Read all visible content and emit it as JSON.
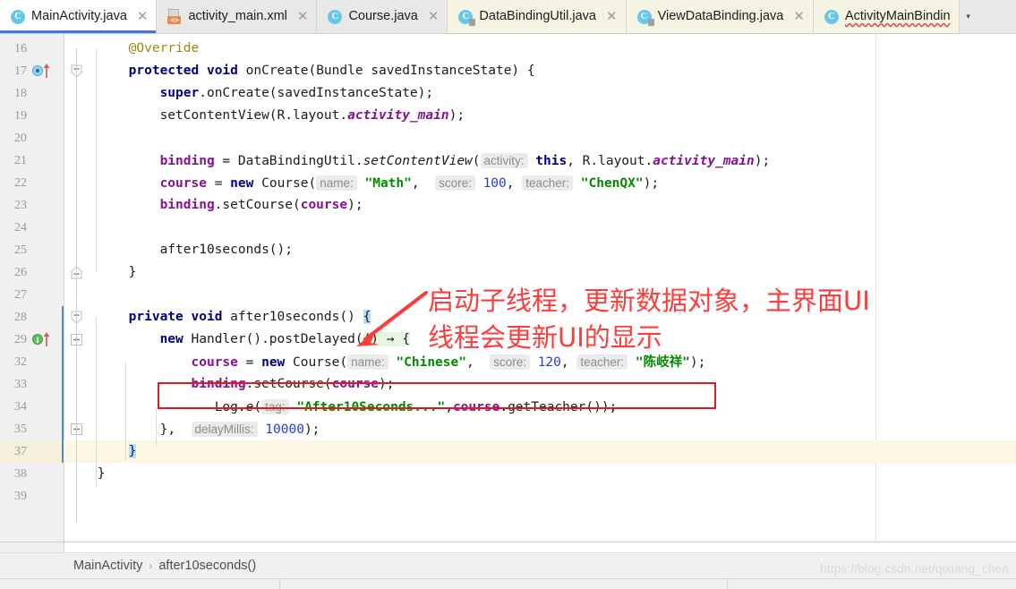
{
  "tabs": [
    {
      "label": "MainActivity.java",
      "icon": "java-class-icon",
      "state": "active",
      "closable": true
    },
    {
      "label": "activity_main.xml",
      "icon": "xml-file-icon",
      "state": "inactive",
      "closable": true
    },
    {
      "label": "Course.java",
      "icon": "java-class-icon",
      "state": "inactive",
      "closable": true
    },
    {
      "label": "DataBindingUtil.java",
      "icon": "java-library-class-icon",
      "state": "library",
      "closable": true
    },
    {
      "label": "ViewDataBinding.java",
      "icon": "java-library-class-icon",
      "state": "library",
      "closable": true
    },
    {
      "label": "ActivityMainBindin",
      "icon": "java-class-icon",
      "state": "library",
      "closable": false,
      "error": true
    }
  ],
  "tabbar": {
    "overflow_chevron": "▾",
    "close_glyph": "✕"
  },
  "editor": {
    "lines": [
      {
        "num": "16",
        "markers": [],
        "fold": "",
        "changed": false,
        "highlight": false,
        "tokens": [
          {
            "t": "indent",
            "v": "     "
          },
          {
            "t": "anno",
            "v": "@Override"
          }
        ]
      },
      {
        "num": "17",
        "markers": [
          "override-marker"
        ],
        "fold": "collapse",
        "changed": false,
        "highlight": false,
        "tokens": [
          {
            "t": "indent",
            "v": "     "
          },
          {
            "t": "kw",
            "v": "protected"
          },
          {
            "t": "plain",
            "v": " "
          },
          {
            "t": "kw",
            "v": "void"
          },
          {
            "t": "plain",
            "v": " onCreate(Bundle savedInstanceState) {"
          }
        ]
      },
      {
        "num": "18",
        "markers": [],
        "fold": "",
        "changed": false,
        "highlight": false,
        "tokens": [
          {
            "t": "indent",
            "v": "         "
          },
          {
            "t": "kw",
            "v": "super"
          },
          {
            "t": "plain",
            "v": ".onCreate(savedInstanceState);"
          }
        ]
      },
      {
        "num": "19",
        "markers": [],
        "fold": "",
        "changed": false,
        "highlight": false,
        "tokens": [
          {
            "t": "indent",
            "v": "         "
          },
          {
            "t": "plain",
            "v": "setContentView(R.layout."
          },
          {
            "t": "stat",
            "v": "activity_main"
          },
          {
            "t": "plain",
            "v": ");"
          }
        ]
      },
      {
        "num": "20",
        "markers": [],
        "fold": "",
        "changed": false,
        "highlight": false,
        "tokens": []
      },
      {
        "num": "21",
        "markers": [],
        "fold": "",
        "changed": false,
        "highlight": false,
        "tokens": [
          {
            "t": "indent",
            "v": "         "
          },
          {
            "t": "fld",
            "v": "binding"
          },
          {
            "t": "plain",
            "v": " = DataBindingUtil."
          },
          {
            "t": "mtd",
            "v": "setContentView"
          },
          {
            "t": "plain",
            "v": "("
          },
          {
            "t": "hint",
            "v": "activity:"
          },
          {
            "t": "plain",
            "v": " "
          },
          {
            "t": "kw",
            "v": "this"
          },
          {
            "t": "plain",
            "v": ", R.layout."
          },
          {
            "t": "stat",
            "v": "activity_main"
          },
          {
            "t": "plain",
            "v": ");"
          }
        ]
      },
      {
        "num": "22",
        "markers": [],
        "fold": "",
        "changed": false,
        "highlight": false,
        "tokens": [
          {
            "t": "indent",
            "v": "         "
          },
          {
            "t": "fld",
            "v": "course"
          },
          {
            "t": "plain",
            "v": " = "
          },
          {
            "t": "kw",
            "v": "new"
          },
          {
            "t": "plain",
            "v": " Course("
          },
          {
            "t": "hint",
            "v": "name:"
          },
          {
            "t": "plain",
            "v": " "
          },
          {
            "t": "str",
            "v": "\"Math\""
          },
          {
            "t": "plain",
            "v": ",  "
          },
          {
            "t": "hint",
            "v": "score:"
          },
          {
            "t": "plain",
            "v": " "
          },
          {
            "t": "num",
            "v": "100"
          },
          {
            "t": "plain",
            "v": ", "
          },
          {
            "t": "hint",
            "v": "teacher:"
          },
          {
            "t": "plain",
            "v": " "
          },
          {
            "t": "str",
            "v": "\"ChenQX\""
          },
          {
            "t": "plain",
            "v": ");"
          }
        ]
      },
      {
        "num": "23",
        "markers": [],
        "fold": "",
        "changed": false,
        "highlight": false,
        "tokens": [
          {
            "t": "indent",
            "v": "         "
          },
          {
            "t": "fld",
            "v": "binding"
          },
          {
            "t": "plain",
            "v": ".setCourse("
          },
          {
            "t": "fld",
            "v": "course"
          },
          {
            "t": "plain",
            "v": ");"
          }
        ]
      },
      {
        "num": "24",
        "markers": [],
        "fold": "",
        "changed": false,
        "highlight": false,
        "tokens": []
      },
      {
        "num": "25",
        "markers": [],
        "fold": "",
        "changed": false,
        "highlight": false,
        "tokens": [
          {
            "t": "indent",
            "v": "         "
          },
          {
            "t": "plain",
            "v": "after10seconds();"
          }
        ]
      },
      {
        "num": "26",
        "markers": [],
        "fold": "expand-end",
        "changed": false,
        "highlight": false,
        "tokens": [
          {
            "t": "indent",
            "v": "     "
          },
          {
            "t": "brc",
            "v": "}"
          }
        ]
      },
      {
        "num": "27",
        "markers": [],
        "fold": "",
        "changed": false,
        "highlight": false,
        "tokens": []
      },
      {
        "num": "28",
        "markers": [],
        "fold": "collapse",
        "changed": true,
        "highlight": false,
        "tokens": [
          {
            "t": "indent",
            "v": "     "
          },
          {
            "t": "kw",
            "v": "private"
          },
          {
            "t": "plain",
            "v": " "
          },
          {
            "t": "kw",
            "v": "void"
          },
          {
            "t": "plain",
            "v": " after10seconds() "
          },
          {
            "t": "bracehl",
            "v": "{"
          }
        ]
      },
      {
        "num": "29",
        "markers": [
          "run-marker"
        ],
        "fold": "plus",
        "changed": true,
        "highlight": false,
        "tokens": [
          {
            "t": "indent",
            "v": "         "
          },
          {
            "t": "kw",
            "v": "new"
          },
          {
            "t": "plain",
            "v": " Handler().postDelayed("
          },
          {
            "t": "softhl",
            "v": "() → {"
          }
        ]
      },
      {
        "num": "32",
        "markers": [],
        "fold": "",
        "changed": true,
        "highlight": false,
        "tokens": [
          {
            "t": "indent",
            "v": "             "
          },
          {
            "t": "fld",
            "v": "course"
          },
          {
            "t": "plain",
            "v": " = "
          },
          {
            "t": "kw",
            "v": "new"
          },
          {
            "t": "plain",
            "v": " Course("
          },
          {
            "t": "hint",
            "v": "name:"
          },
          {
            "t": "plain",
            "v": " "
          },
          {
            "t": "str",
            "v": "\"Chinese\""
          },
          {
            "t": "plain",
            "v": ",  "
          },
          {
            "t": "hint",
            "v": "score:"
          },
          {
            "t": "plain",
            "v": " "
          },
          {
            "t": "num",
            "v": "120"
          },
          {
            "t": "plain",
            "v": ", "
          },
          {
            "t": "hint",
            "v": "teacher:"
          },
          {
            "t": "plain",
            "v": " "
          },
          {
            "t": "str",
            "v": "\"陈岐祥\""
          },
          {
            "t": "plain",
            "v": ");"
          }
        ]
      },
      {
        "num": "33",
        "markers": [],
        "fold": "",
        "changed": true,
        "highlight": false,
        "tokens": [
          {
            "t": "indent",
            "v": "             "
          },
          {
            "t": "fld",
            "v": "binding"
          },
          {
            "t": "plain",
            "v": ".setCourse("
          },
          {
            "t": "fld",
            "v": "course"
          },
          {
            "t": "plain",
            "v": ");"
          }
        ]
      },
      {
        "num": "34",
        "markers": [],
        "fold": "",
        "changed": true,
        "highlight": false,
        "tokens": [
          {
            "t": "indent",
            "v": "                "
          },
          {
            "t": "plain",
            "v": "Log."
          },
          {
            "t": "mtd",
            "v": "e"
          },
          {
            "t": "plain",
            "v": "("
          },
          {
            "t": "hint",
            "v": "tag:"
          },
          {
            "t": "plain",
            "v": " "
          },
          {
            "t": "str",
            "v": "\"After10Seconds...\""
          },
          {
            "t": "plain",
            "v": ","
          },
          {
            "t": "fld",
            "v": "course"
          },
          {
            "t": "plain",
            "v": ".getTeacher());"
          }
        ]
      },
      {
        "num": "35",
        "markers": [],
        "fold": "plus",
        "changed": true,
        "highlight": false,
        "tokens": [
          {
            "t": "indent",
            "v": "         "
          },
          {
            "t": "brc",
            "v": "}"
          },
          {
            "t": "plain",
            "v": ",  "
          },
          {
            "t": "hint",
            "v": "delayMillis:"
          },
          {
            "t": "plain",
            "v": " "
          },
          {
            "t": "num",
            "v": "10000"
          },
          {
            "t": "plain",
            "v": ");"
          }
        ]
      },
      {
        "num": "37",
        "markers": [],
        "fold": "collapse-end",
        "changed": true,
        "highlight": true,
        "tokens": [
          {
            "t": "indent",
            "v": "     "
          },
          {
            "t": "bracehl",
            "v": "}"
          }
        ]
      },
      {
        "num": "38",
        "markers": [],
        "fold": "",
        "changed": false,
        "highlight": false,
        "tokens": [
          {
            "t": "indent",
            "v": " "
          },
          {
            "t": "brc",
            "v": "}"
          }
        ]
      },
      {
        "num": "39",
        "markers": [],
        "fold": "",
        "changed": false,
        "highlight": false,
        "tokens": []
      }
    ]
  },
  "annotation": {
    "text": "启动子线程，更新数据对象，主界面UI\n线程会更新UI的显示",
    "color": "#fd3c3c",
    "arrow_name": "annotation-arrow",
    "highlight_box_color": "#e01b1b"
  },
  "breadcrumb": {
    "items": [
      "MainActivity",
      "after10seconds()"
    ],
    "separator": "›"
  },
  "watermark": {
    "text": "https://blog.csdn.net/qixiang_chen"
  },
  "colors": {
    "keyword": "#000080",
    "string": "#018a01",
    "number": "#2540d8",
    "field": "#871094",
    "annotation_text": "#9e880d",
    "hint_bg": "#ebebeb",
    "accent_tab": "#3d7cc9",
    "change_marker": "#5789c7",
    "highlight_row": "#fdf8e3"
  }
}
